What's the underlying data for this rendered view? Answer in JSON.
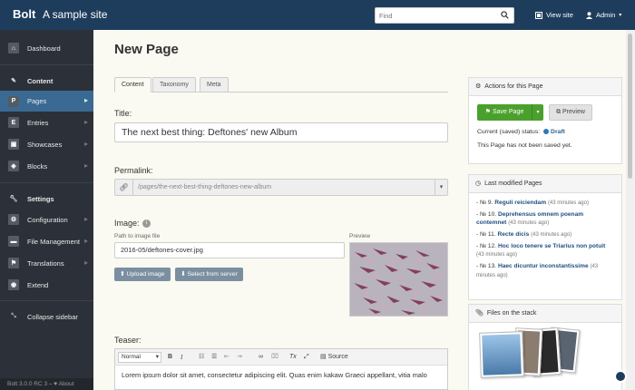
{
  "topbar": {
    "brand": "Bolt",
    "site_title": "A sample site",
    "search_placeholder": "Find",
    "view_site": "View site",
    "admin": "Admin"
  },
  "sidebar": {
    "dashboard": "Dashboard",
    "content_head": "Content",
    "pages": "Pages",
    "entries": "Entries",
    "showcases": "Showcases",
    "blocks": "Blocks",
    "settings_head": "Settings",
    "configuration": "Configuration",
    "file_management": "File Management",
    "translations": "Translations",
    "extend": "Extend",
    "collapse": "Collapse sidebar",
    "version": "Bolt 3.0.0 RC 3 – ♥ About"
  },
  "main": {
    "page_title": "New Page",
    "tabs": [
      "Content",
      "Taxonomy",
      "Meta"
    ],
    "title_label": "Title:",
    "title_value": "The next best thing: Deftones' new Album",
    "permalink_label": "Permalink:",
    "permalink_value": "/pages/the-next-best-thing-deftones-new-album",
    "image_label": "Image:",
    "path_label": "Path to image file",
    "path_value": "2016-05/deftones-cover.jpg",
    "preview_label": "Preview",
    "upload_label": "Upload image",
    "select_label": "Select from server",
    "teaser_label": "Teaser:",
    "editor_format": "Normal",
    "editor_source": "Source",
    "teaser_text": "Lorem ipsum dolor sit amet, consectetur adipiscing elit. Quas enim kakaw Graeci appellant, vitia malo"
  },
  "actions": {
    "title": "Actions for this Page",
    "save": "Save Page",
    "preview": "Preview",
    "status_prefix": "Current (saved) status:",
    "status": "Draft",
    "not_saved": "This Page has not been saved yet."
  },
  "last_modified": {
    "title": "Last modified Pages",
    "items": [
      {
        "num": "№ 9.",
        "title": "Reguli reiciendam",
        "ago": "(43 minutes ago)"
      },
      {
        "num": "№ 10.",
        "title": "Deprehensus omnem poenam contemnet",
        "ago": "(43 minutes ago)"
      },
      {
        "num": "№ 11.",
        "title": "Recte dicis",
        "ago": "(43 minutes ago)"
      },
      {
        "num": "№ 12.",
        "title": "Hoc loco tenere se Triarius non potuit",
        "ago": "(43 minutes ago)"
      },
      {
        "num": "№ 13.",
        "title": "Haec dicuntur inconstantissime",
        "ago": "(43 minutes ago)"
      }
    ]
  },
  "stack": {
    "title": "Files on the stack"
  }
}
